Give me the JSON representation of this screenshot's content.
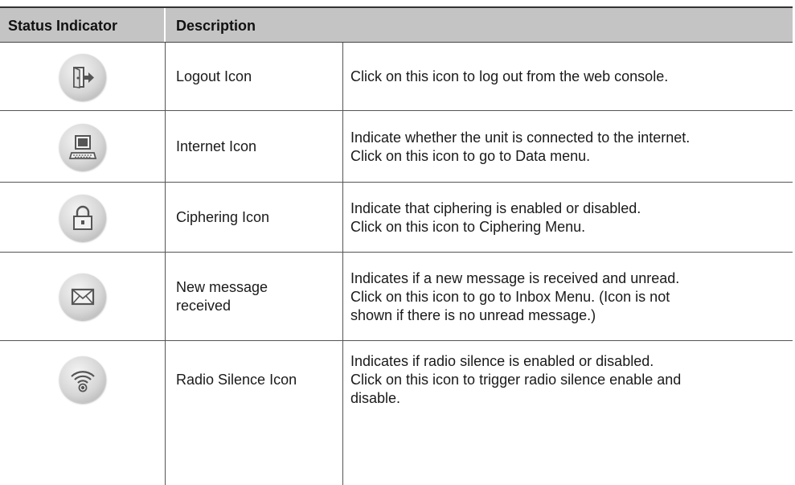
{
  "table": {
    "headers": {
      "indicator": "Status Indicator",
      "description": "Description"
    },
    "rows": [
      {
        "icon": "logout-icon",
        "name_lines": [
          "Logout Icon"
        ],
        "desc_lines": [
          "Click on this icon to log out from the web console."
        ]
      },
      {
        "icon": "internet-icon",
        "name_lines": [
          "Internet Icon"
        ],
        "desc_lines": [
          "Indicate whether the unit is connected to the internet.",
          "Click on this icon to go to Data menu."
        ]
      },
      {
        "icon": "lock-icon",
        "name_lines": [
          "Ciphering Icon"
        ],
        "desc_lines": [
          "Indicate that ciphering is enabled or disabled.",
          "Click on this icon to Ciphering Menu."
        ]
      },
      {
        "icon": "envelope-icon",
        "name_lines": [
          "New message",
          "received"
        ],
        "desc_lines": [
          "Indicates if a new message is received and unread.",
          "Click on this icon to go to Inbox Menu. (Icon is not",
          "shown if there is no unread message.)"
        ]
      },
      {
        "icon": "radio-silence-icon",
        "name_lines": [
          "Radio Silence Icon"
        ],
        "desc_lines": [
          "Indicates if radio silence is enabled or disabled.",
          "Click on this icon to trigger radio silence enable and",
          "disable."
        ]
      }
    ]
  },
  "colors": {
    "header_bg": "#c4c4c4",
    "rule": "#555555",
    "icon_gray": "#555555"
  }
}
